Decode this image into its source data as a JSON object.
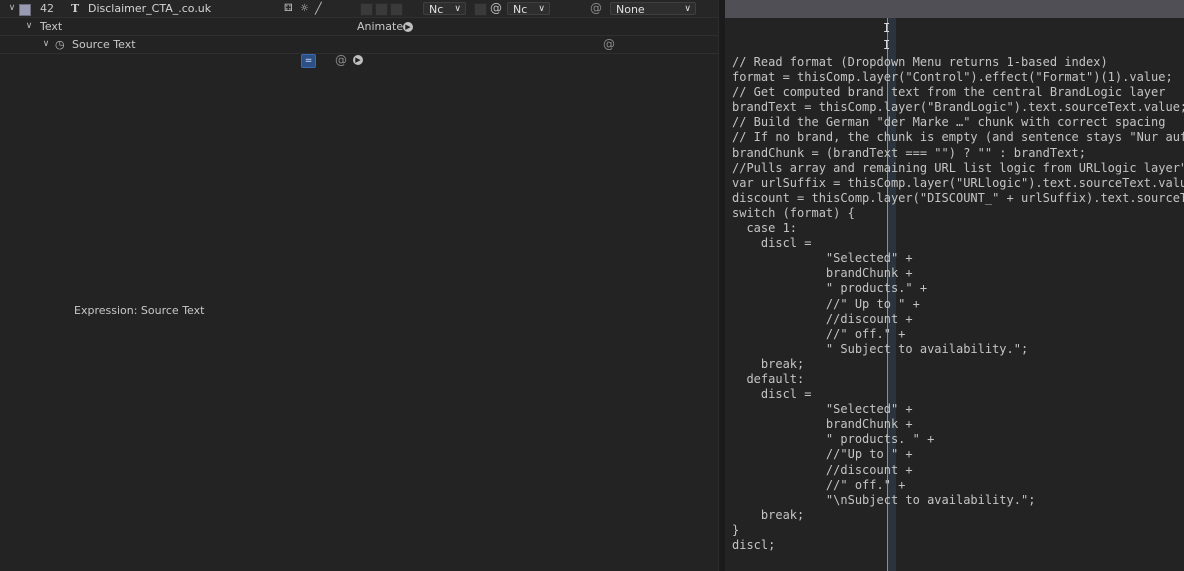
{
  "layer": {
    "number": "42",
    "type_glyph": "T",
    "name": "Disclaimer_CTA_.co.uk",
    "dropdown_a": "Nc",
    "dropdown_b": "Nc",
    "parent": "None"
  },
  "text_group": {
    "label": "Text",
    "animate_label": "Animate:"
  },
  "source_text": {
    "label": "Source Text"
  },
  "expression": {
    "label": "Expression: Source Text",
    "eq_symbol": "="
  },
  "code_lines": [
    "// Read format (Dropdown Menu returns 1-based index)",
    "format = thisComp.layer(\"Control\").effect(\"Format\")(1).value;",
    "// Get computed brand text from the central BrandLogic layer",
    "brandText = thisComp.layer(\"BrandLogic\").text.sourceText.value;",
    "// Build the German \"der Marke …\" chunk with correct spacing",
    "// If no brand, the chunk is empty (and sentence stays \"Nur auf",
    "brandChunk = (brandText === \"\") ? \"\" : brandText;",
    "//Pulls array and remaining URL list logic from URLlogic layer\"",
    "var urlSuffix = thisComp.layer(\"URLlogic\").text.sourceText.valu",
    "discount = thisComp.layer(\"DISCOUNT_\" + urlSuffix).text.sourceT",
    "switch (format) {",
    "  case 1:",
    "    discl =",
    "             \"Selected\" +",
    "             brandChunk +",
    "             \" products.\" +",
    "             //\" Up to \" +",
    "             //discount +",
    "             //\" off.\" +",
    "             \" Subject to availability.\";",
    "    break;",
    "  default:",
    "    discl =",
    "             \"Selected\" +",
    "             brandChunk +",
    "             \" products. \" +",
    "             //\"Up to \" +",
    "             //discount +",
    "             //\" off.\" +",
    "             \"\\nSubject to availability.\";",
    "    break;",
    "}",
    "discl;"
  ],
  "colors": {
    "label_swatch": "#9a9ab2",
    "cursor": "#5a9bd8",
    "eq_button": "#2c4f86"
  },
  "icons": [
    "chevron-down-icon",
    "text-layer-icon",
    "shy-icon",
    "collapse-icon",
    "fx-icon",
    "motion-blur-icon",
    "stopwatch-icon",
    "spiral-icon",
    "play-icon",
    "ibeam-cursor-icon"
  ]
}
